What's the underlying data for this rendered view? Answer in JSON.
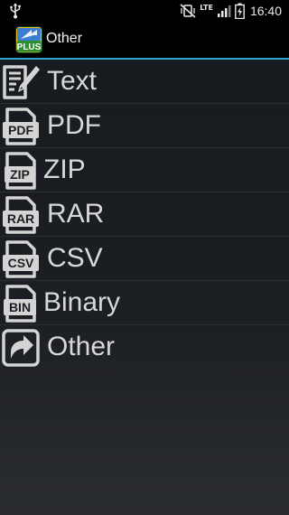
{
  "status_bar": {
    "network": "LTE",
    "time": "16:40"
  },
  "action_bar": {
    "app_icon_text": "PLUS",
    "title": "Other"
  },
  "file_types": [
    {
      "label": "Text",
      "icon": "text-file-icon",
      "badge": ""
    },
    {
      "label": "PDF",
      "icon": "pdf-file-icon",
      "badge": "PDF"
    },
    {
      "label": "ZIP",
      "icon": "zip-file-icon",
      "badge": "ZIP"
    },
    {
      "label": "RAR",
      "icon": "rar-file-icon",
      "badge": "RAR"
    },
    {
      "label": "CSV",
      "icon": "csv-file-icon",
      "badge": "CSV"
    },
    {
      "label": "Binary",
      "icon": "binary-file-icon",
      "badge": "BIN"
    },
    {
      "label": "Other",
      "icon": "other-link-icon",
      "badge": ""
    }
  ],
  "colors": {
    "accent": "#2fa6d0",
    "text": "#d8d8d8",
    "background": "#1b1e22"
  }
}
